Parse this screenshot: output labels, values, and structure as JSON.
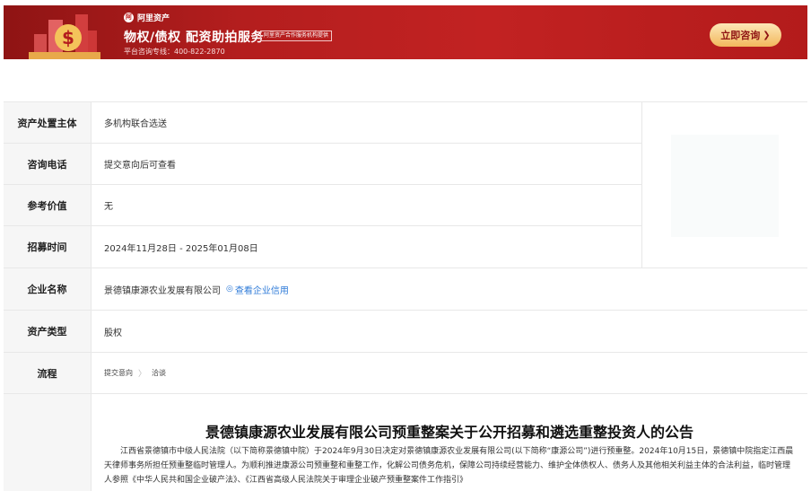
{
  "banner": {
    "brand": "阿里资产",
    "brand_mark": "阿",
    "title": "物权/债权  配资助拍服务",
    "badge": "阿里资产合作服务机构提供",
    "hotline": "平台咨询专线：400-822-2870",
    "consult_button": "立即咨询",
    "consult_arrow": "❯"
  },
  "info": {
    "rows": [
      {
        "label": "资产处置主体",
        "value": "多机构联合选送"
      },
      {
        "label": "咨询电话",
        "value": "提交意向后可查看"
      },
      {
        "label": "参考价值",
        "value": "无"
      },
      {
        "label": "招募时间",
        "value": "2024年11月28日 - 2025年01月08日"
      },
      {
        "label": "企业名称",
        "value": "景德镇康源农业发展有限公司",
        "link": "查看企业信用"
      },
      {
        "label": "资产类型",
        "value": "股权"
      },
      {
        "label": "流程",
        "steps": [
          "提交意向",
          "洽谈"
        ],
        "separator": "〉"
      }
    ]
  },
  "announcement": {
    "title": "景德镇康源农业发展有限公司预重整案关于公开招募和遴选重整投资人的公告",
    "body": "江西省景德镇市中级人民法院（以下简称景德镇中院）于2024年9月30日决定对景德镇康源农业发展有限公司(以下简称“康源公司”)进行预重整。2024年10月15日，景德镇中院指定江西晨天律师事务所担任预重整临时管理人。为顺利推进康源公司预重整和重整工作，化解公司债务危机，保障公司持续经营能力、维护全体债权人、债务人及其他相关利益主体的合法利益，临时管理人参照《中华人民共和国企业破产法》、《江西省高级人民法院关于审理企业破产预重整案件工作指引》"
  },
  "colors": {
    "banner_red": "#b41e1e",
    "button_gold": "#f2b85c",
    "link_blue": "#2f7bd8",
    "label_bg": "#f6f6f6"
  }
}
